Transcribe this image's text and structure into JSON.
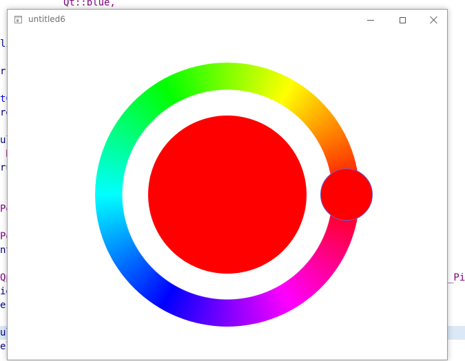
{
  "background_editor": {
    "lines": [
      {
        "text": "Qt::blue,",
        "color": "#800080"
      },
      {
        "text": "li",
        "color": "#000080"
      },
      {
        "text": "r.",
        "color": "#000080"
      },
      {
        "text": "tC",
        "color": "#0000ff"
      },
      {
        "text": "re",
        "color": "#000080"
      },
      {
        "text": "ul",
        "color": "#000080"
      },
      {
        "text": " N",
        "color": "#800080"
      },
      {
        "text": "ru",
        "color": "#000080"
      },
      {
        "text": "Po",
        "color": "#800080"
      },
      {
        "text": "Po",
        "color": "#800080"
      },
      {
        "text": "nt",
        "color": "#000080"
      },
      {
        "text": "Qp",
        "color": "#800080"
      },
      {
        "text": "io",
        "color": "#000080"
      },
      {
        "text": "e(",
        "color": "#000080"
      },
      {
        "text": "ul",
        "color": "#000080"
      },
      {
        "text": "el",
        "color": "#000080"
      },
      {
        "text": "_Pi",
        "color": "#800080"
      }
    ]
  },
  "window": {
    "title": "untitled6",
    "icon": "app-window-icon",
    "controls": {
      "minimize_icon": "minimize-icon",
      "maximize_icon": "maximize-icon",
      "close_icon": "close-icon"
    }
  },
  "color_picker": {
    "ring": "hue-ring",
    "selected_color": "#ff0000",
    "handle_color": "#ff0000",
    "handle_border_color": "#6a5acd"
  }
}
